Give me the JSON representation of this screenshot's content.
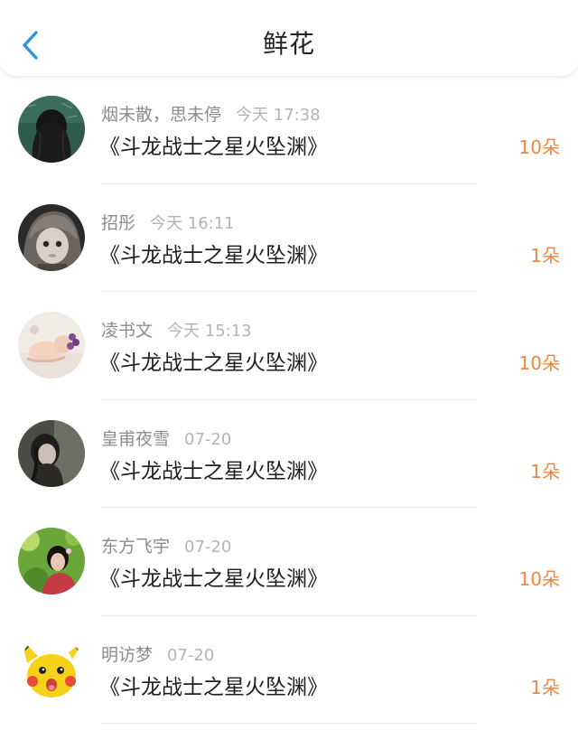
{
  "header": {
    "title": "鲜花",
    "back_icon": "chevron-left-icon",
    "accent_color": "#2d95e8"
  },
  "amount_color": "#f0863c",
  "items": [
    {
      "user": "烟未散，思未停",
      "time": "今天 17:38",
      "book": "《斗龙战士之星火坠渊》",
      "amount": "10朵",
      "avatar": "avatar-girl-long-hair"
    },
    {
      "user": "招彤",
      "time": "今天 16:11",
      "book": "《斗龙战士之星火坠渊》",
      "amount": "1朵",
      "avatar": "avatar-child-hood"
    },
    {
      "user": "凌书文",
      "time": "今天 15:13",
      "book": "《斗龙战士之星火坠渊》",
      "amount": "10朵",
      "avatar": "avatar-baby"
    },
    {
      "user": "皇甫夜雪",
      "time": "07-20",
      "book": "《斗龙战士之星火坠渊》",
      "amount": "1朵",
      "avatar": "avatar-girl-dark"
    },
    {
      "user": "东方飞宇",
      "time": "07-20",
      "book": "《斗龙战士之星火坠渊》",
      "amount": "10朵",
      "avatar": "avatar-girl-garden"
    },
    {
      "user": "明访梦",
      "time": "07-20",
      "book": "《斗龙战士之星火坠渊》",
      "amount": "1朵",
      "avatar": "avatar-pikachu"
    }
  ]
}
